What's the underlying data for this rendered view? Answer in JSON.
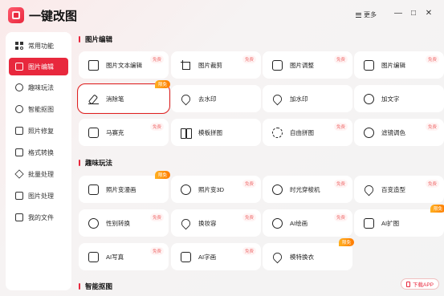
{
  "app": {
    "title": "一键改图",
    "more_label": "更多",
    "minimize": "—",
    "maximize": "□",
    "close": "✕"
  },
  "sidebar": {
    "items": [
      {
        "label": "常用功能",
        "icon": "grid-icon",
        "active": false
      },
      {
        "label": "图片编辑",
        "icon": "edit-icon",
        "active": true
      },
      {
        "label": "趣味玩法",
        "icon": "fun-icon",
        "active": false
      },
      {
        "label": "智能抠图",
        "icon": "target-icon",
        "active": false
      },
      {
        "label": "照片修复",
        "icon": "repair-icon",
        "active": false
      },
      {
        "label": "格式转换",
        "icon": "convert-icon",
        "active": false
      },
      {
        "label": "批量处理",
        "icon": "layers-icon",
        "active": false
      },
      {
        "label": "图片处理",
        "icon": "image-icon",
        "active": false
      },
      {
        "label": "我的文件",
        "icon": "file-icon",
        "active": false
      }
    ]
  },
  "sections": [
    {
      "title": "图片编辑"
    },
    {
      "title": "趣味玩法"
    },
    {
      "title": "智能抠图"
    }
  ],
  "cards": [
    {
      "label": "图片文本编辑",
      "tag": "免费",
      "icon": "doc-edit-icon"
    },
    {
      "label": "图片裁剪",
      "tag": "免费",
      "icon": "crop-icon"
    },
    {
      "label": "图片调整",
      "tag": "免费",
      "icon": "adjust-icon"
    },
    {
      "label": "图片编辑",
      "tag": "免费",
      "icon": "image-edit-icon"
    },
    {
      "label": "消除笔",
      "tag": "限免",
      "icon": "eraser-pen-icon"
    },
    {
      "label": "去水印",
      "tag": "",
      "icon": "remove-watermark-icon"
    },
    {
      "label": "加水印",
      "tag": "",
      "icon": "add-watermark-icon"
    },
    {
      "label": "加文字",
      "tag": "",
      "icon": "add-text-icon"
    },
    {
      "label": "马赛克",
      "tag": "免费",
      "icon": "mosaic-icon"
    },
    {
      "label": "模板拼图",
      "tag": "",
      "icon": "template-collage-icon"
    },
    {
      "label": "自由拼图",
      "tag": "免费",
      "icon": "free-collage-icon"
    },
    {
      "label": "滤镜调色",
      "tag": "免费",
      "icon": "filter-icon"
    },
    {
      "label": "照片变漫画",
      "tag": "限免",
      "icon": "cartoon-icon"
    },
    {
      "label": "照片变3D",
      "tag": "免费",
      "icon": "photo-3d-icon"
    },
    {
      "label": "时光穿梭机",
      "tag": "免费",
      "icon": "time-machine-icon"
    },
    {
      "label": "百变造型",
      "tag": "免费",
      "icon": "style-icon"
    },
    {
      "label": "性别转换",
      "tag": "免费",
      "icon": "gender-icon"
    },
    {
      "label": "换妆容",
      "tag": "免费",
      "icon": "makeup-icon"
    },
    {
      "label": "AI绘画",
      "tag": "免费",
      "icon": "ai-paint-icon"
    },
    {
      "label": "AI扩图",
      "tag": "限免",
      "icon": "ai-expand-icon"
    },
    {
      "label": "AI写真",
      "tag": "免费",
      "icon": "ai-portrait-icon"
    },
    {
      "label": "AI字画",
      "tag": "免费",
      "icon": "ai-calligraphy-icon"
    },
    {
      "label": "模特换衣",
      "tag": "限免",
      "icon": "outfit-icon"
    }
  ],
  "download": {
    "label": "下载APP"
  }
}
